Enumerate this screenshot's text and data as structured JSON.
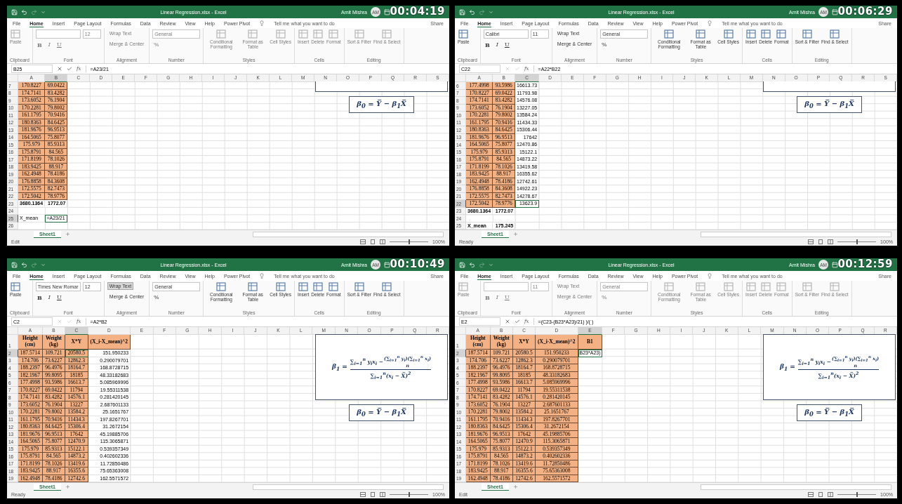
{
  "panels": [
    {
      "timestamp": "00:04:19",
      "title": "Linear Regression.xlsx - Excel",
      "user": "Amit Mishra",
      "initials": "AM",
      "tabs": [
        {
          "label": "File",
          "selected": false
        },
        {
          "label": "Home",
          "selected": true
        },
        {
          "label": "Insert",
          "selected": false
        },
        {
          "label": "Page Layout",
          "selected": false
        },
        {
          "label": "Formulas",
          "selected": false
        },
        {
          "label": "Data",
          "selected": false
        },
        {
          "label": "Review",
          "selected": false
        },
        {
          "label": "View",
          "selected": false
        },
        {
          "label": "Help",
          "selected": false
        },
        {
          "label": "Power Pivot",
          "selected": false
        }
      ],
      "tell_me": "Tell me what you want to do",
      "share": "Share",
      "ribbon": {
        "disabled": true,
        "groups": [
          {
            "label": "Clipboard",
            "commands": [
              {
                "kind": "large",
                "label": "Paste"
              }
            ]
          },
          {
            "label": "Font",
            "commands": [
              {
                "kind": "font_field"
              },
              {
                "kind": "size_field",
                "value": "12"
              },
              {
                "kind": "bold",
                "label": "B"
              },
              {
                "kind": "italic",
                "label": "I"
              },
              {
                "kind": "underline",
                "label": "U"
              }
            ]
          },
          {
            "label": "Alignment",
            "commands": [
              {
                "kind": "toggle",
                "label": "Wrap Text",
                "on": false
              },
              {
                "kind": "small",
                "label": "Merge & Center"
              }
            ]
          },
          {
            "label": "Number",
            "commands": [
              {
                "kind": "format_field",
                "value": "General"
              },
              {
                "kind": "glyph",
                "label": "%"
              }
            ]
          },
          {
            "label": "Styles",
            "commands": [
              {
                "kind": "large",
                "label": "Conditional Formatting"
              },
              {
                "kind": "large",
                "label": "Format as Table"
              },
              {
                "kind": "large",
                "label": "Cell Styles"
              }
            ]
          },
          {
            "label": "Cells",
            "commands": [
              {
                "kind": "large",
                "label": "Insert"
              },
              {
                "kind": "large",
                "label": "Delete"
              },
              {
                "kind": "large",
                "label": "Format"
              }
            ]
          },
          {
            "label": "Editing",
            "commands": [
              {
                "kind": "large",
                "label": "Sort & Filter"
              },
              {
                "kind": "large",
                "label": "Find & Select"
              }
            ]
          }
        ]
      },
      "name_box": "B25",
      "editing": true,
      "function_label": "fx",
      "formula": "=A23/21",
      "columns": [
        {
          "label": "A",
          "fill": true,
          "selected": false
        },
        {
          "label": "B",
          "fill": true,
          "selected": true
        },
        {
          "label": "C",
          "selected": false
        },
        {
          "label": "D",
          "selected": false
        },
        {
          "label": "E",
          "selected": false
        },
        {
          "label": "F",
          "selected": false
        },
        {
          "label": "G",
          "selected": false
        },
        {
          "label": "H",
          "selected": false
        },
        {
          "label": "I",
          "selected": false
        },
        {
          "label": "J",
          "selected": false
        },
        {
          "label": "K",
          "selected": false
        },
        {
          "label": "L",
          "selected": false
        },
        {
          "label": "M",
          "selected": false
        },
        {
          "label": "N",
          "selected": false
        },
        {
          "label": "O",
          "selected": false
        },
        {
          "label": "P",
          "selected": false
        },
        {
          "label": "Q",
          "selected": false
        },
        {
          "label": "R",
          "selected": false
        },
        {
          "label": "S",
          "selected": false
        }
      ],
      "rows": [
        {
          "n": "7",
          "kind": "data",
          "selected": false,
          "cells": [
            "170.8227",
            "69.0422"
          ]
        },
        {
          "n": "8",
          "kind": "data",
          "selected": false,
          "cells": [
            "174.7141",
            "83.4282"
          ]
        },
        {
          "n": "9",
          "kind": "data",
          "selected": false,
          "cells": [
            "173.6052",
            "76.1904"
          ]
        },
        {
          "n": "10",
          "kind": "data",
          "selected": false,
          "cells": [
            "170.2281",
            "79.8002"
          ]
        },
        {
          "n": "11",
          "kind": "data",
          "selected": false,
          "cells": [
            "161.1795",
            "70.9416"
          ]
        },
        {
          "n": "12",
          "kind": "data",
          "selected": false,
          "cells": [
            "180.8363",
            "84.6425"
          ]
        },
        {
          "n": "13",
          "kind": "data",
          "selected": false,
          "cells": [
            "181.9676",
            "96.9513"
          ]
        },
        {
          "n": "14",
          "kind": "data",
          "selected": false,
          "cells": [
            "164.5065",
            "75.8077"
          ]
        },
        {
          "n": "15",
          "kind": "data",
          "selected": false,
          "cells": [
            "175.979",
            "85.9313"
          ]
        },
        {
          "n": "16",
          "kind": "data",
          "selected": false,
          "cells": [
            "175.8791",
            "84.565"
          ]
        },
        {
          "n": "17",
          "kind": "data",
          "selected": false,
          "cells": [
            "171.8199",
            "78.1026"
          ]
        },
        {
          "n": "18",
          "kind": "data",
          "selected": false,
          "cells": [
            "183.9425",
            "88.917"
          ]
        },
        {
          "n": "19",
          "kind": "data",
          "selected": false,
          "cells": [
            "162.4948",
            "78.4186"
          ]
        },
        {
          "n": "20",
          "kind": "data",
          "selected": false,
          "cells": [
            "176.8858",
            "84.3608"
          ]
        },
        {
          "n": "21",
          "kind": "data",
          "selected": false,
          "cells": [
            "172.5575",
            "82.7473"
          ]
        },
        {
          "n": "22",
          "kind": "data",
          "selected": false,
          "cells": [
            "172.5042",
            "78.9776"
          ]
        },
        {
          "n": "23",
          "kind": "total",
          "selected": false,
          "cells": [
            "3680.1364",
            "1772.07"
          ]
        },
        {
          "n": "24",
          "kind": "plain",
          "selected": false
        },
        {
          "n": "25",
          "kind": "plain",
          "selected": true,
          "cells": [
            "X_mean",
            "=A23/21"
          ]
        },
        {
          "n": "26",
          "kind": "plain",
          "selected": false
        }
      ],
      "equations": [
        {
          "kind": "frame_cut"
        },
        {
          "kind": "beta0",
          "text": "β$_{0}$ = Y̅ − β$_{1}$X̅"
        }
      ],
      "sheet": "Sheet1",
      "status": "Edit",
      "zoom": {
        "level": 0.5,
        "label": "100%"
      }
    },
    {
      "timestamp": "00:06:29",
      "title": "Linear Regression.xlsx - Excel",
      "user": "Amit Mishra",
      "initials": "AM",
      "tabs": [
        {
          "label": "File",
          "selected": false
        },
        {
          "label": "Home",
          "selected": true
        },
        {
          "label": "Insert",
          "selected": false
        },
        {
          "label": "Page Layout",
          "selected": false
        },
        {
          "label": "Formulas",
          "selected": false
        },
        {
          "label": "Data",
          "selected": false
        },
        {
          "label": "Review",
          "selected": false
        },
        {
          "label": "View",
          "selected": false
        },
        {
          "label": "Help",
          "selected": false
        },
        {
          "label": "Power Pivot",
          "selected": false
        }
      ],
      "tell_me": "Tell me what you want to do",
      "share": "Share",
      "ribbon": {
        "disabled": false,
        "groups": [
          {
            "label": "Clipboard",
            "commands": [
              {
                "kind": "large",
                "label": "Paste"
              }
            ]
          },
          {
            "label": "Font",
            "commands": [
              {
                "kind": "font_field",
                "value": "Calibri"
              },
              {
                "kind": "size_field",
                "value": "11"
              },
              {
                "kind": "bold",
                "label": "B"
              },
              {
                "kind": "italic",
                "label": "I"
              },
              {
                "kind": "underline",
                "label": "U"
              }
            ]
          },
          {
            "label": "Alignment",
            "commands": [
              {
                "kind": "toggle",
                "label": "Wrap Text",
                "on": false
              },
              {
                "kind": "small",
                "label": "Merge & Center"
              }
            ]
          },
          {
            "label": "Number",
            "commands": [
              {
                "kind": "format_field",
                "value": "General"
              },
              {
                "kind": "glyph",
                "label": "%"
              }
            ]
          },
          {
            "label": "Styles",
            "commands": [
              {
                "kind": "large",
                "label": "Conditional Formatting"
              },
              {
                "kind": "large",
                "label": "Format as Table"
              },
              {
                "kind": "large",
                "label": "Cell Styles"
              }
            ]
          },
          {
            "label": "Cells",
            "commands": [
              {
                "kind": "large",
                "label": "Insert"
              },
              {
                "kind": "large",
                "label": "Delete"
              },
              {
                "kind": "large",
                "label": "Format"
              }
            ]
          },
          {
            "label": "Editing",
            "commands": [
              {
                "kind": "large",
                "label": "Sort & Filter"
              },
              {
                "kind": "large",
                "label": "Find & Select"
              }
            ]
          }
        ]
      },
      "name_box": "C22",
      "editing": false,
      "function_label": "fx",
      "formula": "=A22*B22",
      "columns": [
        {
          "label": "A",
          "fill": true,
          "selected": false
        },
        {
          "label": "B",
          "fill": true,
          "selected": false
        },
        {
          "label": "C",
          "fill": false,
          "selected": true
        },
        {
          "label": "D",
          "selected": false
        },
        {
          "label": "E",
          "selected": false
        },
        {
          "label": "F",
          "selected": false
        },
        {
          "label": "G",
          "selected": false
        },
        {
          "label": "H",
          "selected": false
        },
        {
          "label": "I",
          "selected": false
        },
        {
          "label": "J",
          "selected": false
        },
        {
          "label": "K",
          "selected": false
        },
        {
          "label": "L",
          "selected": false
        },
        {
          "label": "M",
          "selected": false
        },
        {
          "label": "N",
          "selected": false
        },
        {
          "label": "O",
          "selected": false
        },
        {
          "label": "P",
          "selected": false
        },
        {
          "label": "Q",
          "selected": false
        },
        {
          "label": "R",
          "selected": false
        },
        {
          "label": "S",
          "selected": false
        }
      ],
      "rows": [
        {
          "n": "6",
          "kind": "data",
          "selected": false,
          "cells": [
            "177.4998",
            "93.5986",
            "16613.73"
          ]
        },
        {
          "n": "7",
          "kind": "data",
          "selected": false,
          "cells": [
            "170.8227",
            "69.0422",
            "11793.98"
          ]
        },
        {
          "n": "8",
          "kind": "data",
          "selected": false,
          "cells": [
            "174.7141",
            "83.4282",
            "14576.08"
          ]
        },
        {
          "n": "9",
          "kind": "data",
          "selected": false,
          "cells": [
            "173.6052",
            "76.1904",
            "13227.05"
          ]
        },
        {
          "n": "10",
          "kind": "data",
          "selected": false,
          "cells": [
            "170.2281",
            "79.8002",
            "13584.24"
          ]
        },
        {
          "n": "11",
          "kind": "data",
          "selected": false,
          "cells": [
            "161.1795",
            "70.9416",
            "11434.33"
          ]
        },
        {
          "n": "12",
          "kind": "data",
          "selected": false,
          "cells": [
            "180.8363",
            "84.6425",
            "15306.44"
          ]
        },
        {
          "n": "13",
          "kind": "data",
          "selected": false,
          "cells": [
            "181.9676",
            "96.9513",
            "17642"
          ]
        },
        {
          "n": "14",
          "kind": "data",
          "selected": false,
          "cells": [
            "164.5065",
            "75.8077",
            "12470.86"
          ]
        },
        {
          "n": "15",
          "kind": "data",
          "selected": false,
          "cells": [
            "175.979",
            "85.9313",
            "15122.1"
          ]
        },
        {
          "n": "16",
          "kind": "data",
          "selected": false,
          "cells": [
            "175.8791",
            "84.565",
            "14873.22"
          ]
        },
        {
          "n": "17",
          "kind": "data",
          "selected": false,
          "cells": [
            "171.8199",
            "78.1026",
            "13419.58"
          ]
        },
        {
          "n": "18",
          "kind": "data",
          "selected": false,
          "cells": [
            "183.9425",
            "88.917",
            "16355.62"
          ]
        },
        {
          "n": "19",
          "kind": "data",
          "selected": false,
          "cells": [
            "162.4948",
            "78.4186",
            "12742.61"
          ]
        },
        {
          "n": "20",
          "kind": "data",
          "selected": false,
          "cells": [
            "176.8858",
            "84.3608",
            "14922.23"
          ]
        },
        {
          "n": "21",
          "kind": "data",
          "selected": false,
          "cells": [
            "172.5575",
            "82.7473",
            "14278.67"
          ]
        },
        {
          "n": "22",
          "kind": "data",
          "selected": true,
          "cells": [
            "172.5042",
            "78.9776",
            "13623.9"
          ]
        },
        {
          "n": "23",
          "kind": "total",
          "selected": false,
          "cells": [
            "3680.1364",
            "1772.07"
          ]
        },
        {
          "n": "24",
          "kind": "plain",
          "selected": false
        },
        {
          "n": "25",
          "kind": "total",
          "selected": false,
          "cells": [
            "X_mean",
            "175.245"
          ]
        }
      ],
      "equations": [
        {
          "kind": "frame_cut"
        },
        {
          "kind": "beta0",
          "text": "β$_{0}$ = Y̅ − β$_{1}$X̅"
        }
      ],
      "sheet": "Sheet1",
      "status": "Ready",
      "zoom": {
        "level": 0.5,
        "label": "100%"
      }
    },
    {
      "timestamp": "00:10:49",
      "title": "Linear Regression.xlsx - Excel",
      "user": "Amit Mishra",
      "initials": "AM",
      "tabs": [
        {
          "label": "File",
          "selected": false
        },
        {
          "label": "Home",
          "selected": true
        },
        {
          "label": "Insert",
          "selected": false
        },
        {
          "label": "Page Layout",
          "selected": false
        },
        {
          "label": "Formulas",
          "selected": false
        },
        {
          "label": "Data",
          "selected": false
        },
        {
          "label": "Review",
          "selected": false
        },
        {
          "label": "View",
          "selected": false
        },
        {
          "label": "Help",
          "selected": false
        },
        {
          "label": "Power Pivot",
          "selected": false
        }
      ],
      "tell_me": "Tell me what you want to do",
      "share": "Share",
      "ribbon": {
        "disabled": false,
        "groups": [
          {
            "label": "Clipboard",
            "commands": [
              {
                "kind": "large",
                "label": "Paste"
              }
            ]
          },
          {
            "label": "Font",
            "commands": [
              {
                "kind": "font_field",
                "value": "Times New Romar"
              },
              {
                "kind": "size_field",
                "value": "12"
              },
              {
                "kind": "bold",
                "label": "B"
              },
              {
                "kind": "italic",
                "label": "I"
              },
              {
                "kind": "underline",
                "label": "U"
              }
            ]
          },
          {
            "label": "Alignment",
            "commands": [
              {
                "kind": "toggle",
                "label": "Wrap Text",
                "on": true
              },
              {
                "kind": "small",
                "label": "Merge & Center"
              }
            ]
          },
          {
            "label": "Number",
            "commands": [
              {
                "kind": "format_field",
                "value": "General"
              },
              {
                "kind": "glyph",
                "label": "%"
              }
            ]
          },
          {
            "label": "Styles",
            "commands": [
              {
                "kind": "large",
                "label": "Conditional Formatting"
              },
              {
                "kind": "large",
                "label": "Format as Table"
              },
              {
                "kind": "large",
                "label": "Cell Styles"
              }
            ]
          },
          {
            "label": "Cells",
            "commands": [
              {
                "kind": "large",
                "label": "Insert"
              },
              {
                "kind": "large",
                "label": "Delete"
              },
              {
                "kind": "large",
                "label": "Format"
              }
            ]
          },
          {
            "label": "Editing",
            "commands": [
              {
                "kind": "large",
                "label": "Sort & Filter"
              },
              {
                "kind": "large",
                "label": "Find & Select"
              }
            ]
          }
        ]
      },
      "name_box": "C2",
      "editing": false,
      "function_label": "fx",
      "formula": "=A2*B2",
      "columns": [
        {
          "label": "A",
          "fill": true,
          "header_fill": true,
          "selected": false
        },
        {
          "label": "B",
          "fill": true,
          "header_fill": true,
          "selected": false
        },
        {
          "label": "C",
          "fill": true,
          "header_fill": true,
          "selected": true
        },
        {
          "label": "D",
          "fill": false,
          "header_fill": true,
          "selected": false
        },
        {
          "label": "E",
          "selected": false
        },
        {
          "label": "F",
          "selected": false
        },
        {
          "label": "G",
          "selected": false
        },
        {
          "label": "H",
          "selected": false
        },
        {
          "label": "I",
          "selected": false
        },
        {
          "label": "J",
          "selected": false
        },
        {
          "label": "K",
          "selected": false
        },
        {
          "label": "L",
          "selected": false
        },
        {
          "label": "M",
          "selected": false
        },
        {
          "label": "N",
          "selected": false
        },
        {
          "label": "O",
          "selected": false
        },
        {
          "label": "P",
          "selected": false
        },
        {
          "label": "Q",
          "selected": false
        },
        {
          "label": "R",
          "selected": false
        }
      ],
      "rows": [
        {
          "n": "1",
          "kind": "header",
          "selected": false,
          "cells": [
            "Height (cm)",
            "Weight (kg)",
            "X*Y",
            "(X_i-X_mean)^2"
          ]
        },
        {
          "n": "2",
          "kind": "data",
          "selected": true,
          "cells": [
            "187.5714",
            "109.721",
            "20580.5",
            "151.950233"
          ]
        },
        {
          "n": "3",
          "kind": "data",
          "selected": false,
          "cells": [
            "174.706",
            "73.6227",
            "12862.3",
            "0.290079701"
          ]
        },
        {
          "n": "4",
          "kind": "data",
          "selected": false,
          "cells": [
            "188.2397",
            "96.4976",
            "18164.7",
            "168.8728715"
          ]
        },
        {
          "n": "5",
          "kind": "data",
          "selected": false,
          "cells": [
            "182.1967",
            "99.8095",
            "18185",
            "48.33182683"
          ]
        },
        {
          "n": "6",
          "kind": "data",
          "selected": false,
          "cells": [
            "177.4998",
            "93.5986",
            "16613.7",
            "5.085969996"
          ]
        },
        {
          "n": "7",
          "kind": "data",
          "selected": false,
          "cells": [
            "170.8227",
            "69.0422",
            "11794",
            "19.55311538"
          ]
        },
        {
          "n": "8",
          "kind": "data",
          "selected": false,
          "cells": [
            "174.7141",
            "83.4282",
            "14576.1",
            "0.281420145"
          ]
        },
        {
          "n": "9",
          "kind": "data",
          "selected": false,
          "cells": [
            "173.6052",
            "76.1904",
            "13227",
            "2.687601133"
          ]
        },
        {
          "n": "10",
          "kind": "data",
          "selected": false,
          "cells": [
            "170.2281",
            "79.8002",
            "13584.2",
            "25.1651767"
          ]
        },
        {
          "n": "11",
          "kind": "data",
          "selected": false,
          "cells": [
            "161.1795",
            "70.9416",
            "11434.3",
            "197.8267701"
          ]
        },
        {
          "n": "12",
          "kind": "data",
          "selected": false,
          "cells": [
            "180.8363",
            "84.6425",
            "15306.4",
            "31.2672154"
          ]
        },
        {
          "n": "13",
          "kind": "data",
          "selected": false,
          "cells": [
            "181.9676",
            "96.9513",
            "17642",
            "45.19885706"
          ]
        },
        {
          "n": "14",
          "kind": "data",
          "selected": false,
          "cells": [
            "164.5065",
            "75.8077",
            "12470.9",
            "115.3065871"
          ]
        },
        {
          "n": "15",
          "kind": "data",
          "selected": false,
          "cells": [
            "175.979",
            "85.9313",
            "15122.1",
            "0.539357349"
          ]
        },
        {
          "n": "16",
          "kind": "data",
          "selected": false,
          "cells": [
            "175.8791",
            "84.565",
            "14873.2",
            "0.402602336"
          ]
        },
        {
          "n": "17",
          "kind": "data",
          "selected": false,
          "cells": [
            "171.8199",
            "78.1026",
            "13419.6",
            "11.72850486"
          ]
        },
        {
          "n": "18",
          "kind": "data",
          "selected": false,
          "cells": [
            "183.9425",
            "88.917",
            "16355.6",
            "75.65363008"
          ]
        },
        {
          "n": "19",
          "kind": "data",
          "selected": false,
          "cells": [
            "162.4948",
            "78.4186",
            "12742.6",
            "162.5571572"
          ]
        }
      ],
      "equations": [
        {
          "kind": "beta1",
          "lhs": "β$_{1}$ =",
          "numerator": "∑$_{i=1}$$^{n}$ y$_{i}$x$_{i}$ −",
          "fraction_top": "(∑$_{i=1}$$^{n}$ y$_{i}$)(∑$_{i=1}$$^{n}$ x$_{i}$)",
          "fraction_bottom": "n",
          "denominator": "∑$_{i=1}$$^{n}$(x$_{i}$ − X̅)$^{2}$"
        },
        {
          "kind": "beta0",
          "text": "β$_{0}$ = Y̅ − β$_{1}$X̅"
        }
      ],
      "sheet": "Sheet1",
      "status": "Ready",
      "zoom": {
        "level": 0.5,
        "label": "100%"
      }
    },
    {
      "timestamp": "00:12:59",
      "title": "Linear Regression.xlsx - Excel",
      "user": "Amit Mishra",
      "initials": "AM",
      "tabs": [
        {
          "label": "File",
          "selected": false
        },
        {
          "label": "Home",
          "selected": true
        },
        {
          "label": "Insert",
          "selected": false
        },
        {
          "label": "Page Layout",
          "selected": false
        },
        {
          "label": "Formulas",
          "selected": false
        },
        {
          "label": "Data",
          "selected": false
        },
        {
          "label": "Review",
          "selected": false
        },
        {
          "label": "View",
          "selected": false
        },
        {
          "label": "Help",
          "selected": false
        },
        {
          "label": "Power Pivot",
          "selected": false
        }
      ],
      "tell_me": "Tell me what you want to do",
      "share": "Share",
      "ribbon": {
        "disabled": true,
        "groups": [
          {
            "label": "Clipboard",
            "commands": [
              {
                "kind": "large",
                "label": "Paste"
              }
            ]
          },
          {
            "label": "Font",
            "commands": [
              {
                "kind": "font_field"
              },
              {
                "kind": "size_field",
                "value": "11"
              },
              {
                "kind": "bold",
                "label": "B"
              },
              {
                "kind": "italic",
                "label": "I"
              },
              {
                "kind": "underline",
                "label": "U"
              }
            ]
          },
          {
            "label": "Alignment",
            "commands": [
              {
                "kind": "toggle",
                "label": "Wrap Text",
                "on": false
              },
              {
                "kind": "small",
                "label": "Merge & Center"
              }
            ]
          },
          {
            "label": "Number",
            "commands": [
              {
                "kind": "format_field",
                "value": "General"
              },
              {
                "kind": "glyph",
                "label": "%"
              }
            ]
          },
          {
            "label": "Styles",
            "commands": [
              {
                "kind": "large",
                "label": "Conditional Formatting"
              },
              {
                "kind": "large",
                "label": "Format as Table"
              },
              {
                "kind": "large",
                "label": "Cell Styles"
              }
            ]
          },
          {
            "label": "Cells",
            "commands": [
              {
                "kind": "large",
                "label": "Insert"
              },
              {
                "kind": "large",
                "label": "Delete"
              },
              {
                "kind": "large",
                "label": "Format"
              }
            ]
          },
          {
            "label": "Editing",
            "commands": [
              {
                "kind": "large",
                "label": "Sort & Filter"
              },
              {
                "kind": "large",
                "label": "Find & Select"
              }
            ]
          }
        ]
      },
      "name_box": "E2",
      "editing": true,
      "function_label": "fx",
      "formula": "=(C23-(B23*A23)/21) )/( )",
      "columns": [
        {
          "label": "A",
          "fill": true,
          "header_fill": true,
          "selected": false
        },
        {
          "label": "B",
          "fill": true,
          "header_fill": true,
          "selected": false
        },
        {
          "label": "C",
          "fill": true,
          "header_fill": true,
          "selected": false
        },
        {
          "label": "D",
          "fill": true,
          "header_fill": true,
          "selected": false
        },
        {
          "label": "E",
          "fill": false,
          "header_fill": true,
          "selected": true
        },
        {
          "label": "F",
          "selected": false
        },
        {
          "label": "G",
          "selected": false
        },
        {
          "label": "H",
          "selected": false
        },
        {
          "label": "I",
          "selected": false
        },
        {
          "label": "J",
          "selected": false
        },
        {
          "label": "K",
          "selected": false
        },
        {
          "label": "L",
          "selected": false
        },
        {
          "label": "M",
          "selected": false
        },
        {
          "label": "N",
          "selected": false
        },
        {
          "label": "O",
          "selected": false
        },
        {
          "label": "P",
          "selected": false
        },
        {
          "label": "Q",
          "selected": false
        },
        {
          "label": "R",
          "selected": false
        }
      ],
      "rows": [
        {
          "n": "1",
          "kind": "header",
          "selected": false,
          "cells": [
            "Height (cm)",
            "Weight (kg)",
            "X*Y",
            "(X_i-X_mean)^2",
            "B1"
          ]
        },
        {
          "n": "2",
          "kind": "data",
          "selected": true,
          "cells": [
            "187.5714",
            "109.721",
            "20580.5",
            "151.950233",
            "B23*A23)"
          ]
        },
        {
          "n": "3",
          "kind": "data",
          "selected": false,
          "cells": [
            "174.706",
            "73.6227",
            "12862.3",
            "0.290079701"
          ]
        },
        {
          "n": "4",
          "kind": "data",
          "selected": false,
          "cells": [
            "188.2397",
            "96.4976",
            "18164.7",
            "168.8728715"
          ]
        },
        {
          "n": "5",
          "kind": "data",
          "selected": false,
          "cells": [
            "182.1967",
            "99.8095",
            "18185",
            "48.33182683"
          ]
        },
        {
          "n": "6",
          "kind": "data",
          "selected": false,
          "cells": [
            "177.4998",
            "93.5986",
            "16613.7",
            "5.085969996"
          ]
        },
        {
          "n": "7",
          "kind": "data",
          "selected": false,
          "cells": [
            "170.8227",
            "69.0422",
            "11794",
            "19.55311538"
          ]
        },
        {
          "n": "8",
          "kind": "data",
          "selected": false,
          "cells": [
            "174.7141",
            "83.4282",
            "14576.1",
            "0.281420145"
          ]
        },
        {
          "n": "9",
          "kind": "data",
          "selected": false,
          "cells": [
            "173.6052",
            "76.1904",
            "13227",
            "2.687601133"
          ]
        },
        {
          "n": "10",
          "kind": "data",
          "selected": false,
          "cells": [
            "170.2281",
            "79.8002",
            "13584.2",
            "25.1651767"
          ]
        },
        {
          "n": "11",
          "kind": "data",
          "selected": false,
          "cells": [
            "161.1795",
            "70.9416",
            "11434.3",
            "197.8267701"
          ]
        },
        {
          "n": "12",
          "kind": "data",
          "selected": false,
          "cells": [
            "180.8363",
            "84.6425",
            "15306.4",
            "31.2672154"
          ]
        },
        {
          "n": "13",
          "kind": "data",
          "selected": false,
          "cells": [
            "181.9676",
            "96.9513",
            "17642",
            "45.19885706"
          ]
        },
        {
          "n": "14",
          "kind": "data",
          "selected": false,
          "cells": [
            "164.5065",
            "75.8077",
            "12470.9",
            "115.3065871"
          ]
        },
        {
          "n": "15",
          "kind": "data",
          "selected": false,
          "cells": [
            "175.979",
            "85.9313",
            "15122.1",
            "0.539357349"
          ]
        },
        {
          "n": "16",
          "kind": "data",
          "selected": false,
          "cells": [
            "175.8791",
            "84.565",
            "14873.2",
            "0.402602336"
          ]
        },
        {
          "n": "17",
          "kind": "data",
          "selected": false,
          "cells": [
            "171.8199",
            "78.1026",
            "13419.6",
            "11.72850486"
          ]
        },
        {
          "n": "18",
          "kind": "data",
          "selected": false,
          "cells": [
            "183.9425",
            "88.917",
            "16355.6",
            "75.65363008"
          ]
        },
        {
          "n": "19",
          "kind": "data",
          "selected": false,
          "cells": [
            "162.4948",
            "78.4186",
            "12742.6",
            "162.5571572"
          ]
        }
      ],
      "equations": [
        {
          "kind": "beta1",
          "lhs": "β$_{1}$ =",
          "numerator": "∑$_{i=1}$$^{n}$ y$_{i}$x$_{i}$ −",
          "fraction_top": "(∑$_{i=1}$$^{n}$ y$_{i}$)(∑$_{i=1}$$^{n}$ x$_{i}$)",
          "fraction_bottom": "n",
          "denominator": "∑$_{i=1}$$^{n}$(x$_{i}$ − X̅)$^{2}$"
        },
        {
          "kind": "beta0",
          "text": "β$_{0}$ = Y̅ − β$_{1}$X̅"
        }
      ],
      "sheet": "Sheet1",
      "status": "Edit",
      "zoom": {
        "level": 0.5,
        "label": "100%"
      }
    }
  ]
}
